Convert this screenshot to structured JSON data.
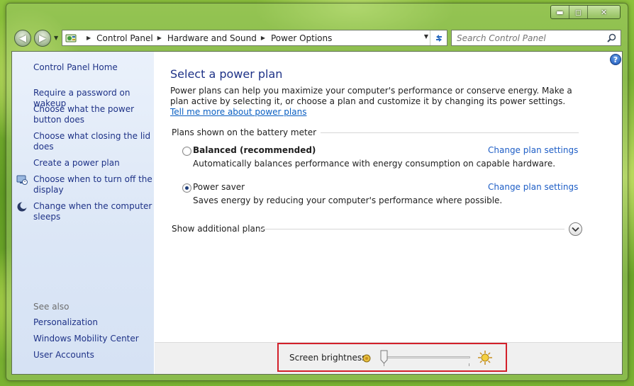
{
  "window": {
    "caption_buttons": {
      "minimize": "▬",
      "maximize": "◻",
      "close": "✕"
    }
  },
  "address": {
    "segments": [
      "Control Panel",
      "Hardware and Sound",
      "Power Options"
    ],
    "icon": "control-panel-icon"
  },
  "search": {
    "placeholder": "Search Control Panel"
  },
  "sidebar": {
    "home": "Control Panel Home",
    "links": [
      "Require a password on wakeup",
      "Choose what the power button does",
      "Choose what closing the lid does",
      "Create a power plan",
      "Choose when to turn off the display",
      "Change when the computer sleeps"
    ],
    "see_also_label": "See also",
    "see_also": [
      "Personalization",
      "Windows Mobility Center",
      "User Accounts"
    ]
  },
  "main": {
    "title": "Select a power plan",
    "intro": "Power plans can help you maximize your computer's performance or conserve energy. Make a plan active by selecting it, or choose a plan and customize it by changing its power settings.",
    "intro_link": "Tell me more about power plans",
    "group_label": "Plans shown on the battery meter",
    "plans": [
      {
        "name": "Balanced (recommended)",
        "description": "Automatically balances performance with energy consumption on capable hardware.",
        "link": "Change plan settings",
        "selected": false
      },
      {
        "name": "Power saver",
        "description": "Saves energy by reducing your computer's performance where possible.",
        "link": "Change plan settings",
        "selected": true
      }
    ],
    "show_additional": "Show additional plans"
  },
  "brightness": {
    "label": "Screen brightness:",
    "level_percent": 0,
    "colors": {
      "highlight": "#d3202a"
    }
  }
}
